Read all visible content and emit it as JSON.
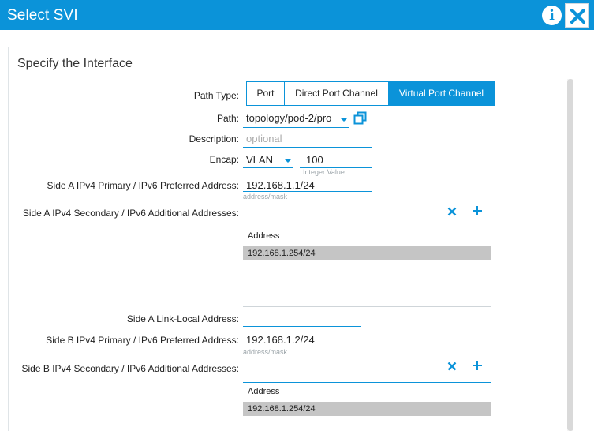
{
  "window": {
    "title": "Select SVI"
  },
  "section": {
    "title": "Specify the Interface"
  },
  "path_type": {
    "label": "Path Type:",
    "options": [
      "Port",
      "Direct Port Channel",
      "Virtual Port Channel"
    ],
    "selected": "Virtual Port Channel"
  },
  "path": {
    "label": "Path:",
    "value": "topology/pod-2/pro"
  },
  "description": {
    "label": "Description:",
    "placeholder": "optional"
  },
  "encap": {
    "label": "Encap:",
    "type": "VLAN",
    "value": "100",
    "hint": "Integer Value"
  },
  "side_a": {
    "primary_label": "Side A IPv4 Primary / IPv6 Preferred Address:",
    "primary_value": "192.168.1.1/24",
    "primary_hint": "address/mask",
    "secondary_label": "Side A IPv4 Secondary / IPv6 Additional Addresses:",
    "table_header": "Address",
    "rows": [
      "192.168.1.254/24"
    ],
    "link_local_label": "Side A Link-Local Address:"
  },
  "side_b": {
    "primary_label": "Side B IPv4 Primary / IPv6 Preferred Address:",
    "primary_value": "192.168.1.2/24",
    "primary_hint": "address/mask",
    "secondary_label": "Side B IPv4 Secondary / IPv6 Additional Addresses:",
    "table_header": "Address",
    "rows": [
      "192.168.1.254/24"
    ]
  },
  "colors": {
    "accent": "#0b93d9",
    "row_fill": "#c5c5c5"
  }
}
